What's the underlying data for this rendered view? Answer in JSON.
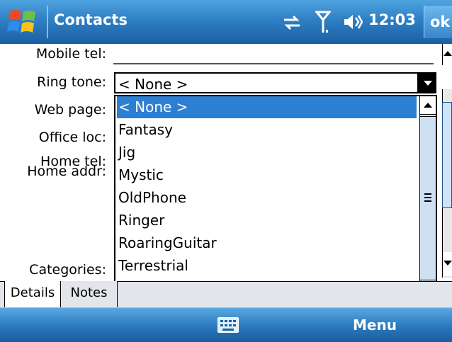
{
  "titlebar": {
    "title": "Contacts",
    "clock": "12:03",
    "ok_label": "ok",
    "icons": [
      "windows-start-icon",
      "connectivity-icon",
      "signal-icon",
      "volume-icon"
    ]
  },
  "form": {
    "fields": [
      {
        "label": "Mobile tel:"
      },
      {
        "label": "Ring tone:",
        "value": "< None >"
      },
      {
        "label": "Web page:"
      },
      {
        "label": "Office loc:"
      },
      {
        "label": "Home tel:"
      },
      {
        "label": "Home addr:"
      },
      {
        "label": "Categories:"
      }
    ]
  },
  "ringtone_list": {
    "selected": "< None >",
    "options": [
      "< None >",
      "Fantasy",
      "Jig",
      "Mystic",
      "OldPhone",
      "Ringer",
      "RoaringGuitar",
      "Terrestrial"
    ]
  },
  "tabs": [
    {
      "label": "Details",
      "active": true
    },
    {
      "label": "Notes",
      "active": false
    }
  ],
  "bottombar": {
    "menu_label": "Menu",
    "keyboard_icon": "keyboard-icon"
  },
  "colors": {
    "titlebar": "#2f7fc4",
    "selection": "#2c7fd3",
    "tabbar": "#e2e6ea"
  }
}
